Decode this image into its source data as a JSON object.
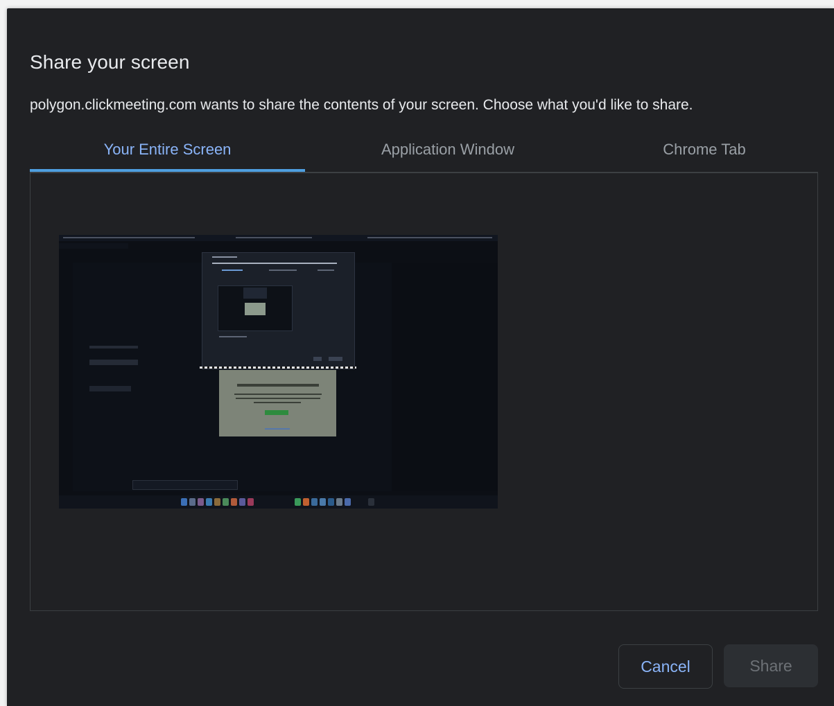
{
  "dialog": {
    "title": "Share your screen",
    "subtitle": "polygon.clickmeeting.com wants to share the contents of your screen. Choose what you'd like to share."
  },
  "tabs": [
    {
      "label": "Your Entire Screen",
      "active": true
    },
    {
      "label": "Application Window",
      "active": false
    },
    {
      "label": "Chrome Tab",
      "active": false
    }
  ],
  "preview": {
    "icon": "screen-thumbnail"
  },
  "buttons": {
    "cancel_label": "Cancel",
    "share_label": "Share",
    "share_enabled": false
  },
  "colors": {
    "background": "#202124",
    "accent": "#8ab4f8",
    "tab_indicator": "#4e9fe0",
    "text": "#e8eaed",
    "muted": "#9aa0a6"
  }
}
